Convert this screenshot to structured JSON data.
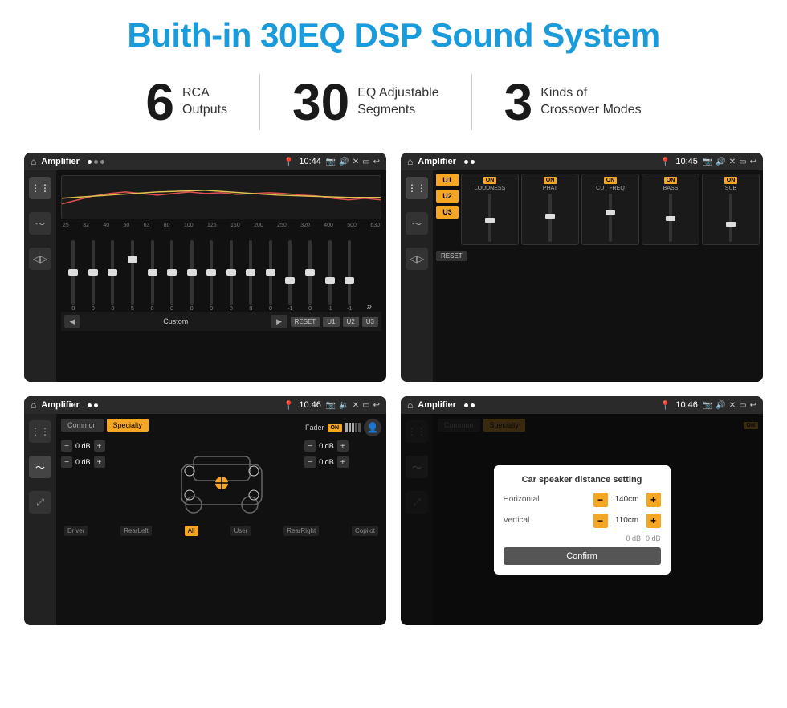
{
  "title": "Buith-in 30EQ DSP Sound System",
  "stats": [
    {
      "number": "6",
      "text_line1": "RCA",
      "text_line2": "Outputs"
    },
    {
      "number": "30",
      "text_line1": "EQ Adjustable",
      "text_line2": "Segments"
    },
    {
      "number": "3",
      "text_line1": "Kinds of",
      "text_line2": "Crossover Modes"
    }
  ],
  "screens": [
    {
      "id": "eq-screen",
      "app_name": "Amplifier",
      "time": "10:44",
      "type": "equalizer",
      "preset": "Custom",
      "buttons": [
        "RESET",
        "U1",
        "U2",
        "U3"
      ],
      "freq_labels": [
        "25",
        "32",
        "40",
        "50",
        "63",
        "80",
        "100",
        "125",
        "160",
        "200",
        "250",
        "320",
        "400",
        "500",
        "630"
      ],
      "slider_values": [
        "0",
        "0",
        "0",
        "5",
        "0",
        "0",
        "0",
        "0",
        "0",
        "0",
        "0",
        "-1",
        "0",
        "-1"
      ]
    },
    {
      "id": "amp-screen",
      "app_name": "Amplifier",
      "time": "10:45",
      "type": "amplifier",
      "u_buttons": [
        "U1",
        "U2",
        "U3"
      ],
      "channels": [
        "LOUDNESS",
        "PHAT",
        "CUT FREQ",
        "BASS",
        "SUB"
      ],
      "reset_label": "RESET"
    },
    {
      "id": "crossover-screen",
      "app_name": "Amplifier",
      "time": "10:46",
      "type": "crossover",
      "tabs": [
        "Common",
        "Specialty"
      ],
      "fader_label": "Fader",
      "fader_on": "ON",
      "db_values": [
        "0 dB",
        "0 dB",
        "0 dB",
        "0 dB"
      ],
      "bottom_labels": [
        "Driver",
        "RearLeft",
        "All",
        "User",
        "RearRight",
        "Copilot"
      ]
    },
    {
      "id": "dialog-screen",
      "app_name": "Amplifier",
      "time": "10:46",
      "type": "dialog",
      "dialog_title": "Car speaker distance setting",
      "horizontal_label": "Horizontal",
      "horizontal_value": "140cm",
      "vertical_label": "Vertical",
      "vertical_value": "110cm",
      "db_right_values": [
        "0 dB",
        "0 dB"
      ],
      "confirm_label": "Confirm",
      "tabs": [
        "Common",
        "Specialty"
      ],
      "fader_on": "ON"
    }
  ]
}
